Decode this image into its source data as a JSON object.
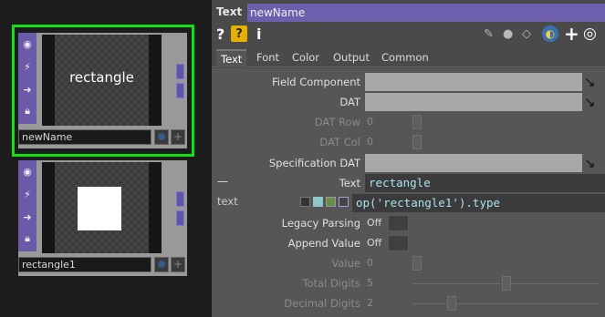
{
  "network": {
    "nodes": [
      {
        "name": "newName",
        "preview_text": "rectangle",
        "selected": true
      },
      {
        "name": "rectangle1",
        "preview_text": "",
        "selected": false
      }
    ],
    "colors": {
      "selection": "#11e011",
      "op_purple": "#6a5aa8"
    }
  },
  "panel": {
    "op_type": "Text",
    "op_name": "newName",
    "toolbar": {
      "help": "?",
      "info": "i",
      "add": "+"
    },
    "tabs": [
      {
        "label": "Text",
        "active": true
      },
      {
        "label": "Font",
        "active": false
      },
      {
        "label": "Color",
        "active": false
      },
      {
        "label": "Output",
        "active": false
      },
      {
        "label": "Common",
        "active": false
      }
    ],
    "params": {
      "field_component": "Field Component",
      "dat": "DAT",
      "dat_row": {
        "label": "DAT Row",
        "value": "0"
      },
      "dat_col": {
        "label": "DAT Col",
        "value": "0"
      },
      "spec_dat": "Specification DAT",
      "text": {
        "label": "Text",
        "value": "rectangle",
        "collapse": "—"
      },
      "text_expr": {
        "label": "text",
        "value": "op('rectangle1').type"
      },
      "legacy_parsing": {
        "label": "Legacy Parsing",
        "value": "Off"
      },
      "append_value": {
        "label": "Append Value",
        "value": "Off"
      },
      "value": {
        "label": "Value",
        "value": "0"
      },
      "total_digits": {
        "label": "Total Digits",
        "value": "5"
      },
      "decimal_digits": {
        "label": "Decimal Digits",
        "value": "2"
      }
    }
  }
}
